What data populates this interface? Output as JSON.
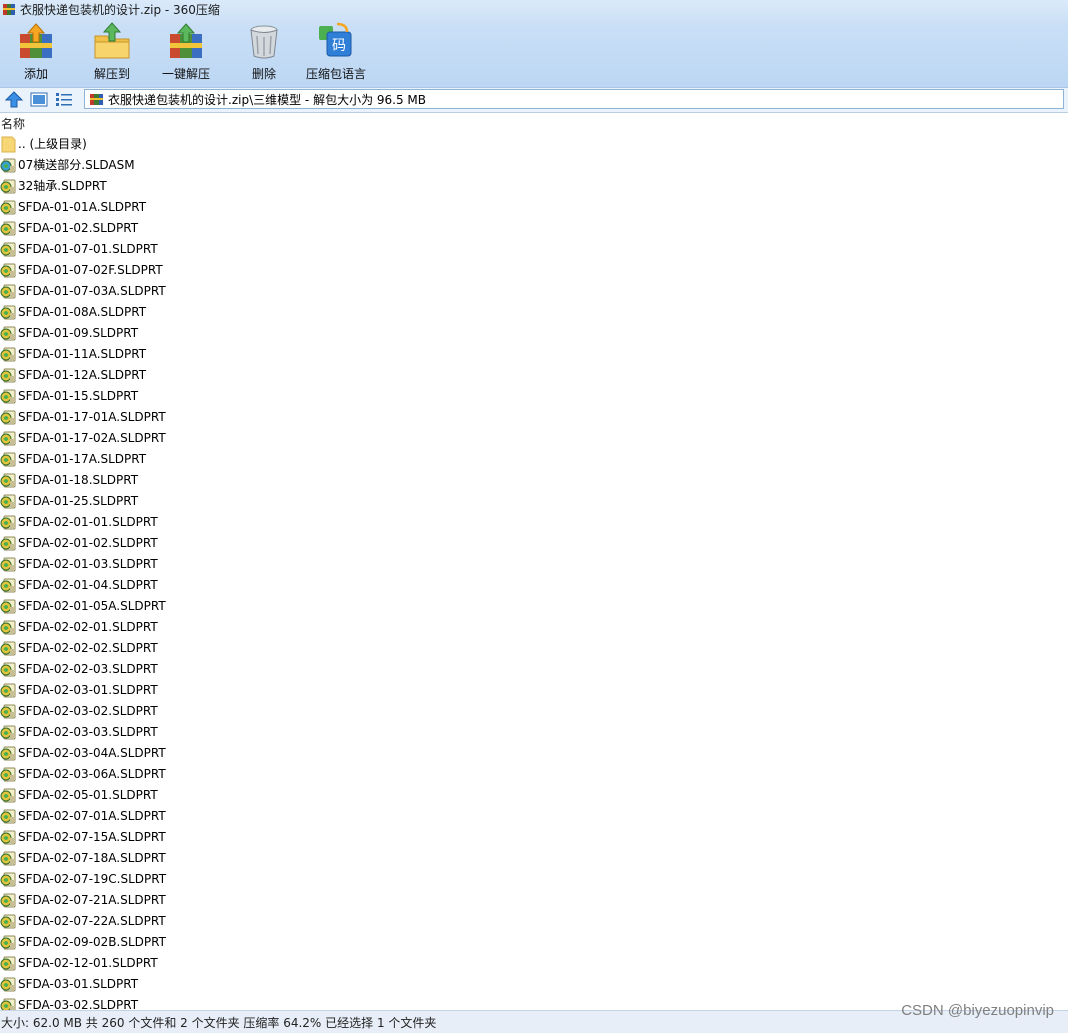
{
  "window": {
    "title": "衣服快递包装机的设计.zip - 360压缩"
  },
  "toolbar": {
    "buttons": [
      {
        "label": "添加",
        "icon": "add-archive-icon"
      },
      {
        "label": "解压到",
        "icon": "extract-to-icon"
      },
      {
        "label": "一键解压",
        "icon": "one-click-extract-icon"
      },
      {
        "label": "删除",
        "icon": "delete-trash-icon"
      },
      {
        "label": "压缩包语言",
        "icon": "archive-encoding-icon"
      }
    ]
  },
  "navbar": {
    "up_icon": "up-arrow-icon",
    "view_icon": "thumbnail-view-icon",
    "list_icon": "details-view-icon",
    "address": "衣服快递包装机的设计.zip\\三维模型 - 解包大小为 96.5 MB"
  },
  "list": {
    "column_name": "名称",
    "parent": ".. (上级目录)",
    "files": [
      "07横送部分.SLDASM",
      "32轴承.SLDPRT",
      "SFDA-01-01A.SLDPRT",
      "SFDA-01-02.SLDPRT",
      "SFDA-01-07-01.SLDPRT",
      "SFDA-01-07-02F.SLDPRT",
      "SFDA-01-07-03A.SLDPRT",
      "SFDA-01-08A.SLDPRT",
      "SFDA-01-09.SLDPRT",
      "SFDA-01-11A.SLDPRT",
      "SFDA-01-12A.SLDPRT",
      "SFDA-01-15.SLDPRT",
      "SFDA-01-17-01A.SLDPRT",
      "SFDA-01-17-02A.SLDPRT",
      "SFDA-01-17A.SLDPRT",
      "SFDA-01-18.SLDPRT",
      "SFDA-01-25.SLDPRT",
      "SFDA-02-01-01.SLDPRT",
      "SFDA-02-01-02.SLDPRT",
      "SFDA-02-01-03.SLDPRT",
      "SFDA-02-01-04.SLDPRT",
      "SFDA-02-01-05A.SLDPRT",
      "SFDA-02-02-01.SLDPRT",
      "SFDA-02-02-02.SLDPRT",
      "SFDA-02-02-03.SLDPRT",
      "SFDA-02-03-01.SLDPRT",
      "SFDA-02-03-02.SLDPRT",
      "SFDA-02-03-03.SLDPRT",
      "SFDA-02-03-04A.SLDPRT",
      "SFDA-02-03-06A.SLDPRT",
      "SFDA-02-05-01.SLDPRT",
      "SFDA-02-07-01A.SLDPRT",
      "SFDA-02-07-15A.SLDPRT",
      "SFDA-02-07-18A.SLDPRT",
      "SFDA-02-07-19C.SLDPRT",
      "SFDA-02-07-21A.SLDPRT",
      "SFDA-02-07-22A.SLDPRT",
      "SFDA-02-09-02B.SLDPRT",
      "SFDA-02-12-01.SLDPRT",
      "SFDA-03-01.SLDPRT",
      "SFDA-03-02.SLDPRT"
    ]
  },
  "status": {
    "text": "大小: 62.0 MB 共 260 个文件和 2 个文件夹 压缩率 64.2% 已经选择 1 个文件夹"
  },
  "watermark": "CSDN @biyezuopinvip"
}
